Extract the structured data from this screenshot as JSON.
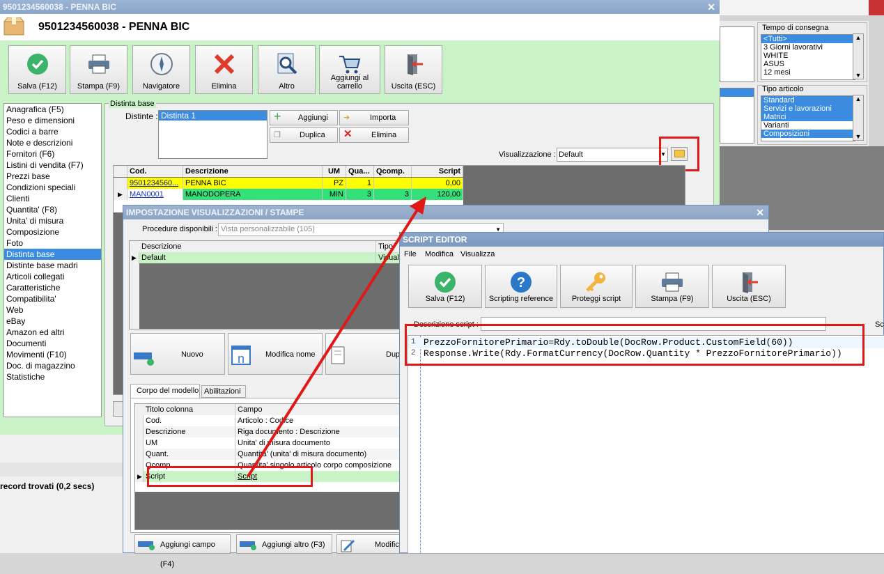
{
  "main": {
    "window_title": "9501234560038 - PENNA BIC",
    "header_title": "9501234560038 - PENNA BIC",
    "toolbar": [
      "Salva (F12)",
      "Stampa (F9)",
      "Navigatore",
      "Elimina",
      "Altro",
      "Aggiungi al carrello",
      "Uscita (ESC)"
    ],
    "sidebar": [
      "Anagrafica (F5)",
      "Peso e dimensioni",
      "Codici a barre",
      "Note e descrizioni",
      "Fornitori (F6)",
      "Listini di vendita (F7)",
      "Prezzi base",
      "Condizioni speciali",
      "Clienti",
      "Quantita' (F8)",
      "Unita' di misura",
      "Composizione",
      "Foto",
      "Distinta base",
      "Distinte base madri",
      "Articoli collegati",
      "Caratteristiche",
      "Compatibilita'",
      "Web",
      "eBay",
      "Amazon ed altri",
      "Documenti",
      "Movimenti (F10)",
      "Doc. di magazzino",
      "Statistiche"
    ],
    "sidebar_selected": "Distinta base",
    "group_title": "Distinta base",
    "distinte_label": "Distinte :",
    "distinte_items": [
      "Distinta 1"
    ],
    "buttons": {
      "aggiungi": "Aggiungi",
      "importa": "Importa",
      "duplica": "Duplica",
      "elimina": "Elimina"
    },
    "visualizzazione_label": "Visualizzazione :",
    "visualizzazione_value": "Default",
    "grid_headers": [
      "Cod.",
      "Descrizione",
      "UM",
      "Qua...",
      "Qcomp.",
      "Script"
    ],
    "grid_rows": [
      [
        "9501234560...",
        "PENNA BIC",
        "PZ",
        "1",
        "",
        "0,00"
      ],
      [
        "MAN0001",
        "MANODOPERA",
        "MIN",
        "3",
        "3",
        "120,00"
      ]
    ],
    "status": "record trovati (0,2 secs)"
  },
  "filters": {
    "tempo_title": "Tempo di consegna",
    "tempo_items": [
      "<Tutti>",
      "3 Giorni lavorativi",
      "WHITE",
      "ASUS",
      "12 mesi"
    ],
    "tipo_title": "Tipo articolo",
    "tipo_items": [
      "Standard",
      "Servizi e lavorazioni",
      "Matrici",
      "Varianti",
      "Composizioni"
    ]
  },
  "imp": {
    "title": "IMPOSTAZIONE VISUALIZZAZIONI / STAMPE",
    "proc_label": "Procedure disponibili :",
    "proc_value": "Vista personalizzabile (105)",
    "list_headers": [
      "Descrizione",
      "Tipo"
    ],
    "list_rows": [
      [
        "Default",
        "Visuali"
      ]
    ],
    "buttons": [
      "Nuovo",
      "Modifica nome",
      "Duplica"
    ],
    "tabs": [
      "Corpo del modello",
      "Abilitazioni"
    ],
    "col_headers": [
      "Titolo colonna",
      "Campo"
    ],
    "col_rows": [
      [
        "Cod.",
        "Articolo : Codice"
      ],
      [
        "Descrizione",
        "Riga documento : Descrizione"
      ],
      [
        "UM",
        "Unita' di misura documento"
      ],
      [
        "Quant.",
        "Quantita' (unita' di misura documento)"
      ],
      [
        "Qcomp.",
        "Quantita' singolo articolo corpo composizione"
      ],
      [
        "Script",
        "Script"
      ]
    ],
    "bottom_buttons": [
      "Aggiungi campo (F4)",
      "Aggiungi altro (F3)",
      "Modific"
    ]
  },
  "editor": {
    "title": "SCRIPT EDITOR",
    "menu": [
      "File",
      "Modifica",
      "Visualizza"
    ],
    "toolbar": [
      "Salva (F12)",
      "Scripting reference",
      "Proteggi script",
      "Stampa (F9)",
      "Uscita (ESC)"
    ],
    "desc_label": "Descrizione script :",
    "side_label": "Scr",
    "lines": [
      "PrezzoFornitorePrimario=Rdy.toDouble(DocRow.Product.CustomField(60))",
      "Response.Write(Rdy.FormatCurrency(DocRow.Quantity * PrezzoFornitorePrimario))"
    ],
    "line_numbers": [
      "1",
      "2"
    ]
  },
  "colors": {
    "accent": "#e01818",
    "green_panel": "#c9f2c6",
    "yellow_row": "#ffff00",
    "green_row": "#33e07a"
  }
}
